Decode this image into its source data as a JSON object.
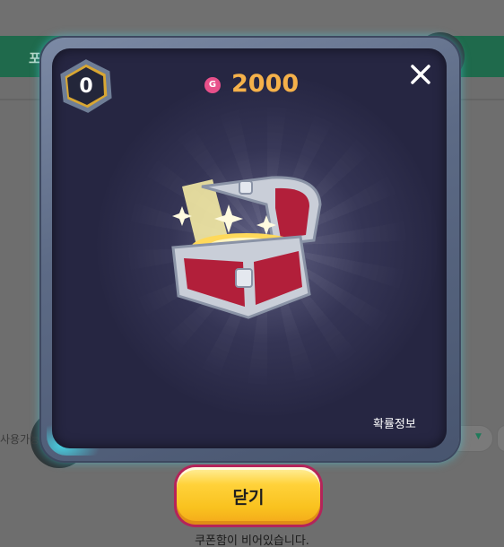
{
  "background": {
    "green_bar_text": "포",
    "filter_label": "사용가능"
  },
  "modal": {
    "level": "0",
    "currency": {
      "icon": "gem-icon",
      "icon_letter": "G",
      "amount": "2000"
    },
    "close_icon": "close-icon",
    "reward_item": "treasure-chest",
    "probability_info": "확률정보"
  },
  "footer": {
    "close_button_label": "닫기",
    "empty_message": "쿠폰함이 비어있습니다."
  },
  "colors": {
    "accent_gold": "#f5b14a",
    "gem_pink": "#e8508a",
    "button_yellow": "#ffd23a",
    "button_border": "#b4245a",
    "frame_glow": "#46d2e6"
  }
}
